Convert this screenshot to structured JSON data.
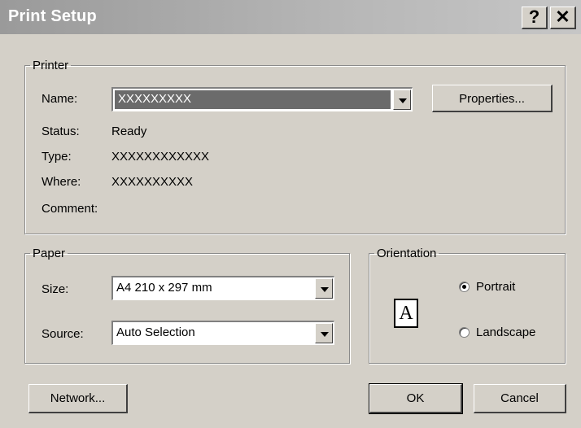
{
  "window": {
    "title": "Print Setup",
    "help_glyph": "?",
    "close_glyph": "✕"
  },
  "printer": {
    "legend": "Printer",
    "name_label": "Name:",
    "name_value": "XXXXXXXXX",
    "properties_button": "Properties...",
    "status_label": "Status:",
    "status_value": "Ready",
    "type_label": "Type:",
    "type_value": "XXXXXXXXXXXX",
    "where_label": "Where:",
    "where_value": "XXXXXXXXXX",
    "comment_label": "Comment:"
  },
  "paper": {
    "legend": "Paper",
    "size_label": "Size:",
    "size_value": "A4 210 x 297 mm",
    "source_label": "Source:",
    "source_value": "Auto Selection"
  },
  "orientation": {
    "legend": "Orientation",
    "page_glyph": "A",
    "portrait_label": "Portrait",
    "landscape_label": "Landscape",
    "selected": "Portrait"
  },
  "buttons": {
    "network": "Network...",
    "ok": "OK",
    "cancel": "Cancel"
  }
}
